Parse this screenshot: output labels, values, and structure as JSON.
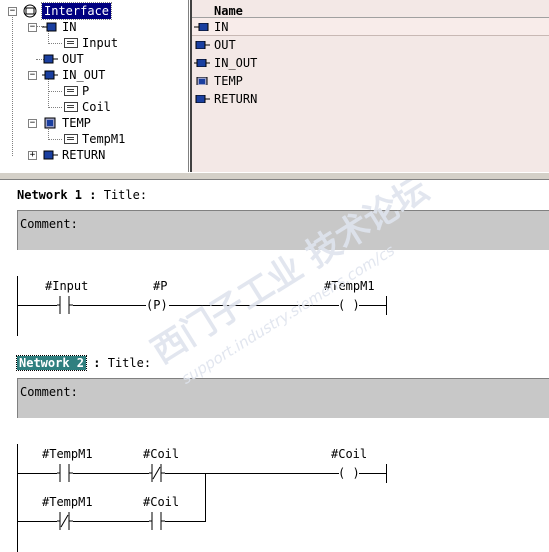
{
  "interface_tree": {
    "root": "Interface",
    "items": [
      {
        "label": "IN",
        "children": [
          "Input"
        ]
      },
      {
        "label": "OUT",
        "children": []
      },
      {
        "label": "IN_OUT",
        "children": [
          "P",
          "Coil"
        ]
      },
      {
        "label": "TEMP",
        "children": [
          "TempM1"
        ]
      },
      {
        "label": "RETURN",
        "children": []
      }
    ]
  },
  "detail_table": {
    "column": "Name",
    "rows": [
      "IN",
      "OUT",
      "IN_OUT",
      "TEMP",
      "RETURN"
    ]
  },
  "networks": [
    {
      "label": "Network 1",
      "separator": ":",
      "title": "Title:",
      "comment": "Comment:",
      "contacts": [
        {
          "operand": "#Input",
          "symbol": "| |"
        },
        {
          "operand": "#P",
          "symbol": "(P)"
        },
        {
          "operand": "#TempM1",
          "symbol": "( )"
        }
      ]
    },
    {
      "label": "Network 2",
      "separator": ":",
      "title": "Title:",
      "comment": "Comment:",
      "rungs": [
        {
          "operand_a": "#TempM1",
          "operand_b": "#Coil",
          "coil": "#Coil"
        },
        {
          "operand_a": "#TempM1",
          "operand_b": "#Coil"
        }
      ]
    }
  ],
  "watermark": {
    "line1": "西门子工业 技术论坛",
    "line2": "support.industry.siemens.com/cs"
  },
  "colors": {
    "selection": "#000080",
    "network2_selection": "#2f7f7f",
    "detail_bg": "#f3e8e6",
    "comment_bg": "#c8c8c8"
  }
}
